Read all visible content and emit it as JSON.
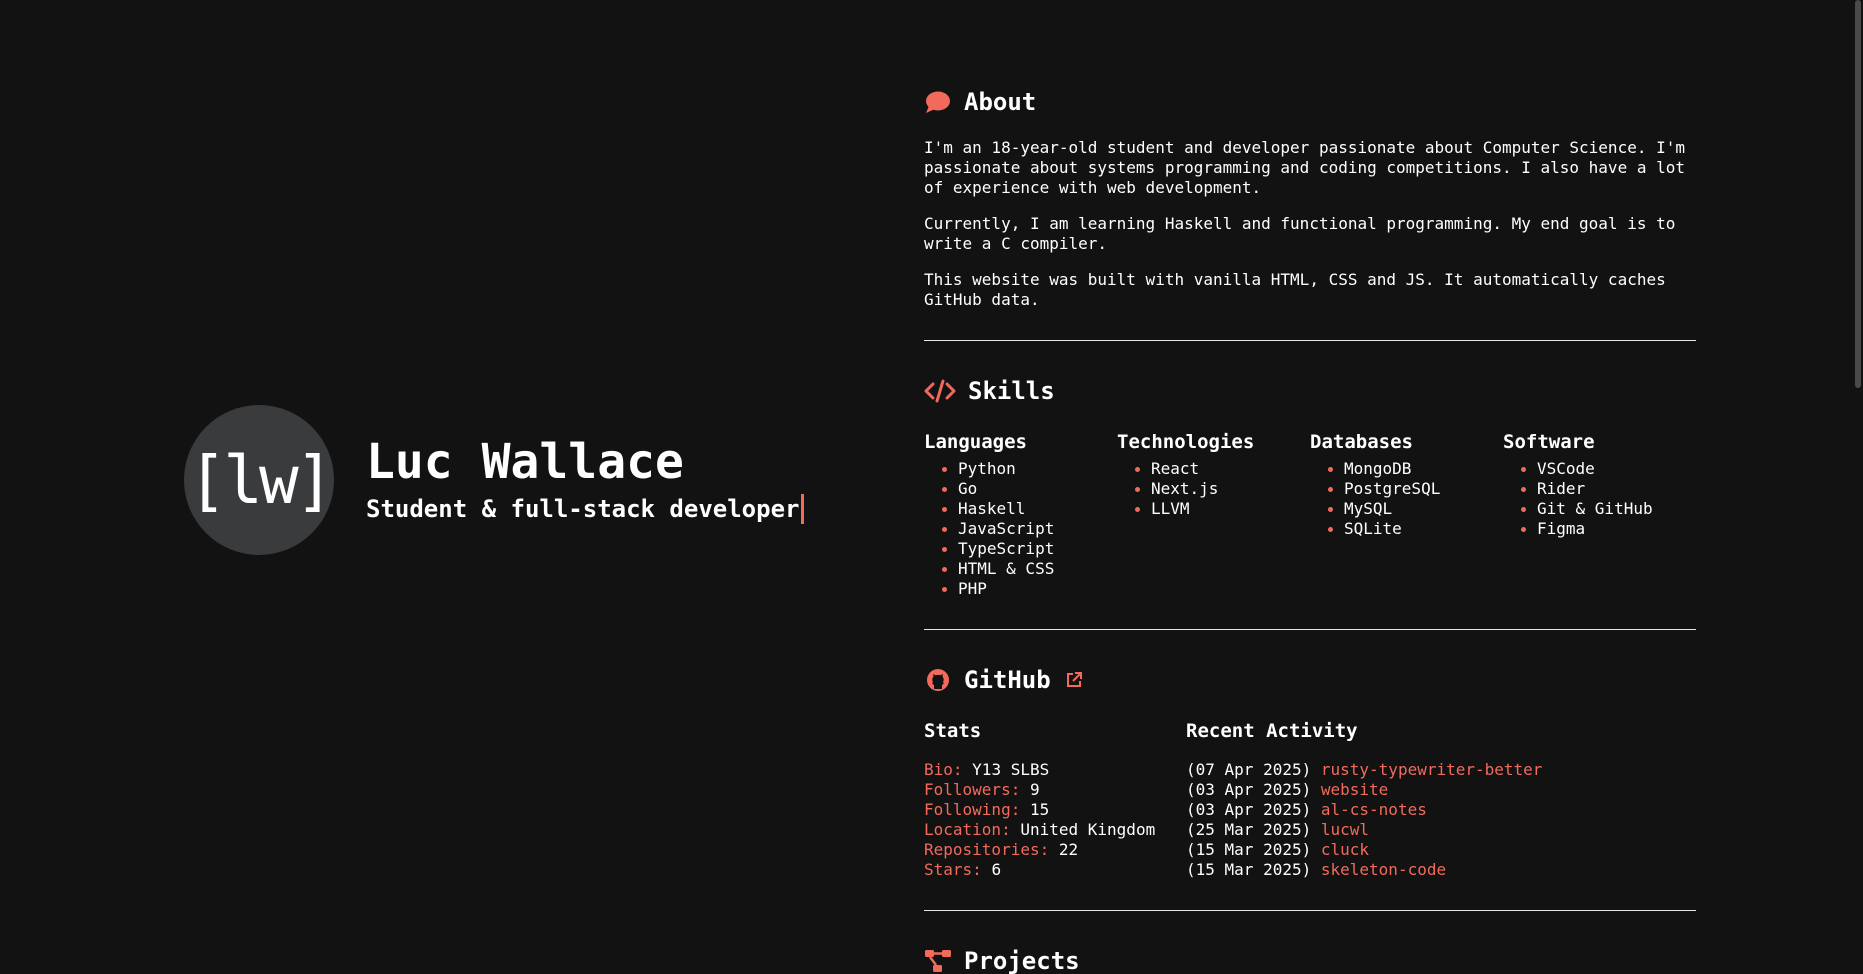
{
  "hero": {
    "avatar_text": "[lw]",
    "name": "Luc Wallace",
    "subtitle": "Student & full-stack developer"
  },
  "about": {
    "title": "About",
    "icon": "speech-bubble-icon",
    "paragraphs": [
      "I'm an 18-year-old student and developer passionate about Computer Science. I'm passionate about systems programming and coding competitions. I also have a lot of experience with web development.",
      "Currently, I am learning Haskell and functional programming. My end goal is to write a C compiler.",
      "This website was built with vanilla HTML, CSS and JS. It automatically caches GitHub data."
    ]
  },
  "skills": {
    "title": "Skills",
    "icon": "code-icon",
    "columns": [
      {
        "heading": "Languages",
        "items": [
          "Python",
          "Go",
          "Haskell",
          "JavaScript",
          "TypeScript",
          "HTML & CSS",
          "PHP"
        ]
      },
      {
        "heading": "Technologies",
        "items": [
          "React",
          "Next.js",
          "LLVM"
        ]
      },
      {
        "heading": "Databases",
        "items": [
          "MongoDB",
          "PostgreSQL",
          "MySQL",
          "SQLite"
        ]
      },
      {
        "heading": "Software",
        "items": [
          "VSCode",
          "Rider",
          "Git & GitHub",
          "Figma"
        ]
      }
    ]
  },
  "github": {
    "title": "GitHub",
    "icon": "github-icon",
    "link_icon": "external-link-icon",
    "stats_heading": "Stats",
    "stats": [
      {
        "key": "Bio:",
        "value": "Y13 SLBS"
      },
      {
        "key": "Followers:",
        "value": "9"
      },
      {
        "key": "Following:",
        "value": "15"
      },
      {
        "key": "Location:",
        "value": "United Kingdom"
      },
      {
        "key": "Repositories:",
        "value": "22"
      },
      {
        "key": "Stars:",
        "value": "6"
      }
    ],
    "activity_heading": "Recent Activity",
    "activity": [
      {
        "date": "(07 Apr 2025)",
        "repo": "rusty-typewriter-better"
      },
      {
        "date": "(03 Apr 2025)",
        "repo": "website"
      },
      {
        "date": "(03 Apr 2025)",
        "repo": "al-cs-notes"
      },
      {
        "date": "(25 Mar 2025)",
        "repo": "lucwl"
      },
      {
        "date": "(15 Mar 2025)",
        "repo": "cluck"
      },
      {
        "date": "(15 Mar 2025)",
        "repo": "skeleton-code"
      }
    ]
  },
  "projects": {
    "title": "Projects",
    "icon": "project-diagram-icon"
  },
  "colors": {
    "background": "#121212",
    "accent": "#f16a5c",
    "text": "#ffffff",
    "avatar_bg": "#3a3b3d"
  }
}
